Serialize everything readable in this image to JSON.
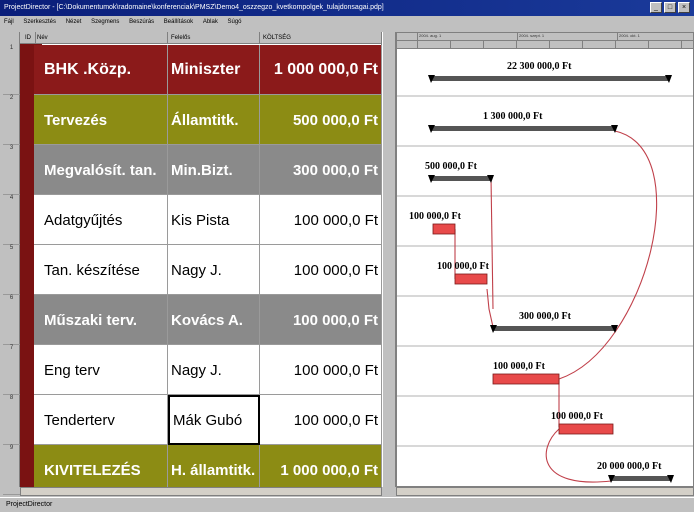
{
  "window": {
    "title": "ProjectDirector - [C:\\Dokumentumok\\radomaine\\konferenciak\\PMSZ\\Demo4_oszzegzo_kvetkompolgek_tulajdonsagai.pdp]",
    "buttons": [
      "_",
      "□",
      "×"
    ]
  },
  "menu": [
    "Fájl",
    "Szerkesztés",
    "Nézet",
    "Szegmens",
    "Beszúrás",
    "Beállítások",
    "Ablak",
    "Súgó"
  ],
  "table": {
    "headers": {
      "id": "ID",
      "name": "Név",
      "owner": "Felelős",
      "cost": "KÖLTSÉG"
    },
    "rows": [
      {
        "num": "1",
        "name": "BHK .Közp.",
        "owner": "Miniszter",
        "cost": "1 000 000,0 Ft",
        "bg": "#8b1a1a",
        "fg": "#ffffff",
        "bold": true
      },
      {
        "num": "2",
        "name": "Tervezés",
        "owner": "Államtitk.",
        "cost": "500 000,0 Ft",
        "bg": "#8c8c14",
        "fg": "#ffffff",
        "bold": true
      },
      {
        "num": "3",
        "name": "Megvalósít. tan.",
        "owner": "Min.Bizt.",
        "cost": "300 000,0 Ft",
        "bg": "#8a8a8a",
        "fg": "#ffffff",
        "bold": true
      },
      {
        "num": "4",
        "name": "Adatgyűjtés",
        "owner": "Kis Pista",
        "cost": "100 000,0 Ft",
        "bg": "#ffffff",
        "fg": "#000000",
        "bold": false
      },
      {
        "num": "5",
        "name": "Tan. készítése",
        "owner": "Nagy J.",
        "cost": "100 000,0 Ft",
        "bg": "#ffffff",
        "fg": "#000000",
        "bold": false
      },
      {
        "num": "6",
        "name": "Műszaki terv.",
        "owner": "Kovács A.",
        "cost": "100 000,0 Ft",
        "bg": "#8a8a8a",
        "fg": "#ffffff",
        "bold": true
      },
      {
        "num": "7",
        "name": "Eng terv",
        "owner": "Nagy J.",
        "cost": "100 000,0 Ft",
        "bg": "#ffffff",
        "fg": "#000000",
        "bold": false
      },
      {
        "num": "8",
        "name": "Tenderterv",
        "owner": "Mák Gubó",
        "cost": "100 000,0 Ft",
        "bg": "#ffffff",
        "fg": "#000000",
        "bold": false
      },
      {
        "num": "9",
        "name": "KIVITELEZÉS",
        "owner": "H. államtitk.",
        "cost": "1 000 000,0 Ft",
        "bg": "#8c8c14",
        "fg": "#ffffff",
        "bold": true
      }
    ]
  },
  "gantt": {
    "timescale_top": [
      "2004. aug. 1",
      "2004. szept. 1",
      "2004. okt. 1"
    ],
    "timescale_bottom": [
      "",
      "",
      "",
      "",
      "",
      "",
      "",
      "",
      ""
    ],
    "bars": [
      {
        "label": "22 300 000,0 Ft",
        "kind": "summary",
        "color": "#555555"
      },
      {
        "label": "1 300 000,0 Ft",
        "kind": "summary",
        "color": "#555555"
      },
      {
        "label": "500 000,0 Ft",
        "kind": "summary",
        "color": "#555555"
      },
      {
        "label": "100 000,0 Ft",
        "kind": "task",
        "color": "#e84a4a"
      },
      {
        "label": "100 000,0 Ft",
        "kind": "task",
        "color": "#e84a4a"
      },
      {
        "label": "300 000,0 Ft",
        "kind": "summary",
        "color": "#555555"
      },
      {
        "label": "100 000,0 Ft",
        "kind": "task",
        "color": "#e84a4a"
      },
      {
        "label": "100 000,0 Ft",
        "kind": "task",
        "color": "#e84a4a"
      },
      {
        "label": "20 000 000,0 Ft",
        "kind": "summary",
        "color": "#555555"
      }
    ],
    "link_color": "#c0404a"
  },
  "status": {
    "text": "ProjectDirector"
  }
}
